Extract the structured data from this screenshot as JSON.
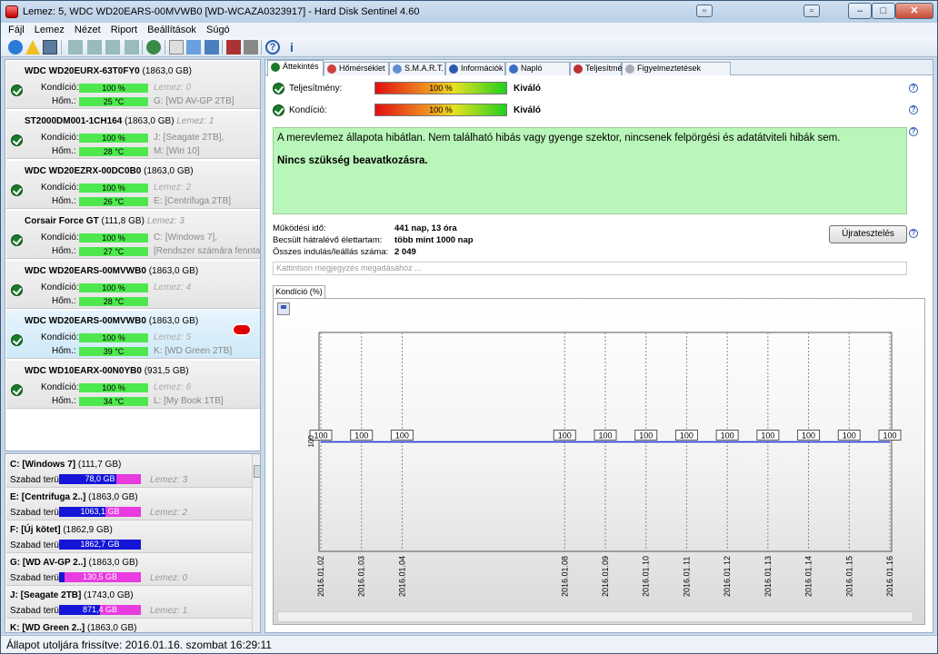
{
  "window": {
    "title": "Lemez: 5, WDC WD20EARS-00MVWB0 [WD-WCAZA0323917]  -  Hard Disk Sentinel 4.60"
  },
  "menu": [
    "Fájl",
    "Lemez",
    "Nézet",
    "Riport",
    "Beállítások",
    "Súgó"
  ],
  "labels": {
    "kondicio": "Kondíció:",
    "hom": "Hőm.:",
    "szabad": "Szabad terület"
  },
  "disks": [
    {
      "name": "WDC WD20EURX-63T0FY0",
      "size": "(1863,0 GB)",
      "kondicio": "100 %",
      "temp": "25 °C",
      "lemez": "Lemez: 0",
      "drive1": "G: [WD AV-GP 2TB]",
      "drive2": ""
    },
    {
      "name": "ST2000DM001-1CH164",
      "size": "(1863,0 GB)",
      "kondicio": "100 %",
      "temp": "28 °C",
      "lemez": "Lemez: 1",
      "drive1": "J: [Seagate 2TB],",
      "drive2": "M: [Win 10]"
    },
    {
      "name": "WDC WD20EZRX-00DC0B0",
      "size": "(1863,0 GB)",
      "kondicio": "100 %",
      "temp": "26 °C",
      "lemez": "Lemez: 2",
      "drive1": "E: [Centrifuga 2TB]",
      "drive2": ""
    },
    {
      "name": "Corsair Force GT",
      "size": "(111,8 GB)",
      "kondicio": "100 %",
      "temp": "27 °C",
      "lemez": "Lemez: 3",
      "drive1": "C: [Windows 7],",
      "drive2": "[Rendszer számára fenntartot"
    },
    {
      "name": "WDC WD20EARS-00MVWB0",
      "size": "(1863,0 GB)",
      "kondicio": "100 %",
      "temp": "28 °C",
      "lemez": "Lemez: 4",
      "drive1": "",
      "drive2": ""
    },
    {
      "name": "WDC WD20EARS-00MVWB0",
      "size": "(1863,0 GB)",
      "kondicio": "100 %",
      "temp": "39 °C",
      "lemez": "Lemez: 5",
      "drive1": "K: [WD Green 2TB]",
      "drive2": ""
    },
    {
      "name": "WDC WD10EARX-00N0YB0",
      "size": "(931,5 GB)",
      "kondicio": "100 %",
      "temp": "34 °C",
      "lemez": "Lemez: 6",
      "drive1": "L: [My Book 1TB]",
      "drive2": ""
    }
  ],
  "volumes": [
    {
      "name": "C: [Windows 7]",
      "size": "(111,7 GB)",
      "free": "78,0 GB",
      "fill": 0.7,
      "lemez": "Lemez: 3"
    },
    {
      "name": "E: [Centrifuga 2..]",
      "size": "(1863,0 GB)",
      "free": "1063,1 GB",
      "fill": 0.57,
      "lemez": "Lemez: 2"
    },
    {
      "name": "F: [Új kötet]",
      "size": "(1862,9 GB)",
      "free": "1862,7 GB",
      "fill": 1.0,
      "lemez": ""
    },
    {
      "name": "G: [WD AV-GP 2..]",
      "size": "(1863,0 GB)",
      "free": "130,5 GB",
      "fill": 0.07,
      "lemez": "Lemez: 0"
    },
    {
      "name": "J: [Seagate 2TB]",
      "size": "(1743,0 GB)",
      "free": "871,4 GB",
      "fill": 0.5,
      "lemez": "Lemez: 1"
    },
    {
      "name": "K: [WD Green 2..]",
      "size": "(1863,0 GB)",
      "free": "",
      "fill": 0,
      "lemez": ""
    }
  ],
  "status": "Állapot utoljára frissítve: 2016.01.16. szombat 16:29:11",
  "tabs": [
    "Áttekintés",
    "Hőmérséklet",
    "S.M.A.R.T.",
    "Információk",
    "Napló",
    "Teljesítmény",
    "Figyelmeztetések"
  ],
  "overview": {
    "perf_label": "Teljesítmény:",
    "perf_value": "100 %",
    "perf_rating": "Kiváló",
    "cond_label": "Kondíció:",
    "cond_value": "100 %",
    "cond_rating": "Kiváló",
    "message": "A merevlemez állapota hibátlan. Nem található hibás vagy gyenge szektor, nincsenek felpörgési és adatátviteli hibák sem.",
    "recommendation": "Nincs szükség beavatkozásra.",
    "uptime_label": "Működési idő:",
    "uptime_value": "441 nap, 13 óra",
    "life_label": "Becsült hátralévő élettartam:",
    "life_value": "több mint 1000 nap",
    "starts_label": "Összes indulás/leállás száma:",
    "starts_value": "2 049",
    "retest_button": "Újratesztelés",
    "note_placeholder": "Kattintson megjegyzés megadásához ..."
  },
  "chart_tab": "Kondíció  (%)",
  "chart_data": {
    "type": "line",
    "x": [
      "2016.01.02",
      "2016.01.03",
      "2016.01.04",
      "2016.01.08",
      "2016.01.09",
      "2016.01.10",
      "2016.01.11",
      "2016.01.12",
      "2016.01.13",
      "2016.01.14",
      "2016.01.15",
      "2016.01.16"
    ],
    "values": [
      100,
      100,
      100,
      100,
      100,
      100,
      100,
      100,
      100,
      100,
      100,
      100
    ],
    "ylabel": "100",
    "line_color": "#1a2ecf"
  }
}
